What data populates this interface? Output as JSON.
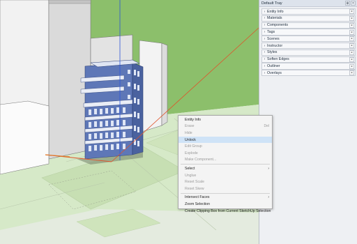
{
  "tray": {
    "title": "Default Tray",
    "pin_glyph": "⊕",
    "close_glyph": "×",
    "item_chevron": "›",
    "item_close": "×",
    "panels": [
      {
        "label": "Entity Info"
      },
      {
        "label": "Materials"
      },
      {
        "label": "Components"
      },
      {
        "label": "Tags"
      },
      {
        "label": "Scenes"
      },
      {
        "label": "Instructor"
      },
      {
        "label": "Styles"
      },
      {
        "label": "Soften Edges"
      },
      {
        "label": "Outliner"
      },
      {
        "label": "Overlays"
      }
    ]
  },
  "context_menu": {
    "entity_info": "Entity Info",
    "erase": "Erase",
    "erase_shortcut": "Del",
    "hide": "Hide",
    "unlock": "Unlock",
    "edit_group": "Edit Group",
    "explode": "Explode",
    "make_component": "Make Component...",
    "select": "Select",
    "select_arrow": "›",
    "unglue": "Unglue",
    "reset_scale": "Reset Scale",
    "reset_skew": "Reset Skew",
    "intersect_faces": "Intersect Faces",
    "intersect_arrow": "›",
    "zoom_selection": "Zoom Selection",
    "clipping_box": "Create Clipping Box from Current SketchUp Selection"
  },
  "colors": {
    "ground": "#d4e7c4",
    "sky_green": "#8bbf6c",
    "highlight": "#cfe3f7",
    "facade_blue": "#5f78b8",
    "axis_red": "#e0522a",
    "axis_blue": "#2b56d8"
  }
}
